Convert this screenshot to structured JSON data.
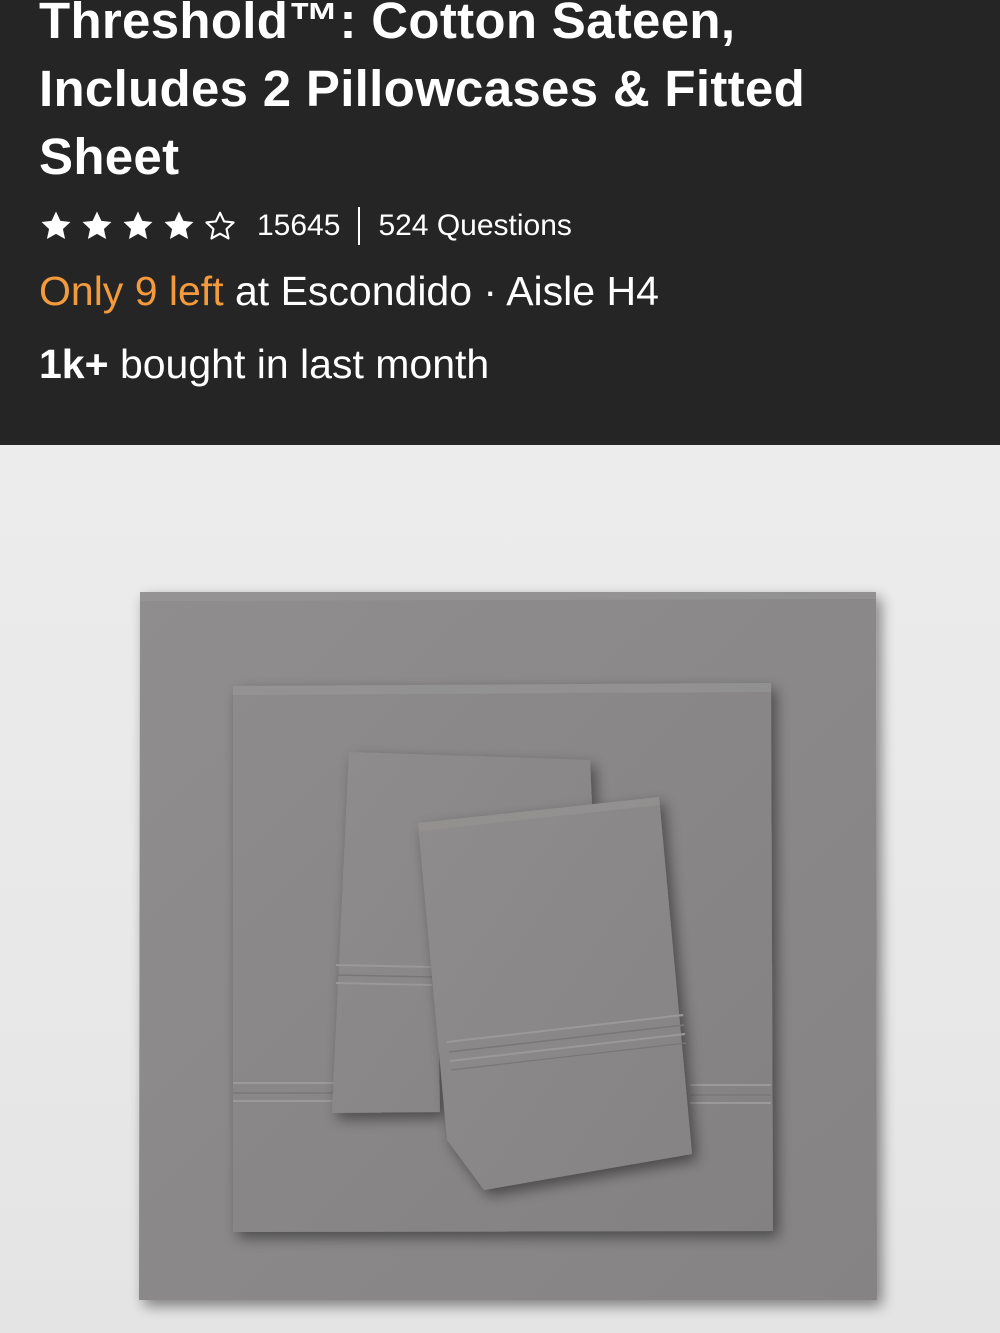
{
  "product": {
    "title_lines": [
      "Threshold™: Cotton Sateen,",
      "Includes 2 Pillowcases & Fitted",
      "Sheet"
    ],
    "rating": {
      "stars": 4,
      "max_stars": 5,
      "count": "15645",
      "questions": "524 Questions"
    },
    "stock": {
      "highlight": "Only 9 left",
      "location": " at Escondido · Aisle H4"
    },
    "social_proof": {
      "count": "1k+",
      "text": " bought in last month"
    },
    "colors": {
      "header_bg": "#252525",
      "stock_accent": "#f39a3c",
      "sheet_gray": "#8a8888"
    }
  }
}
